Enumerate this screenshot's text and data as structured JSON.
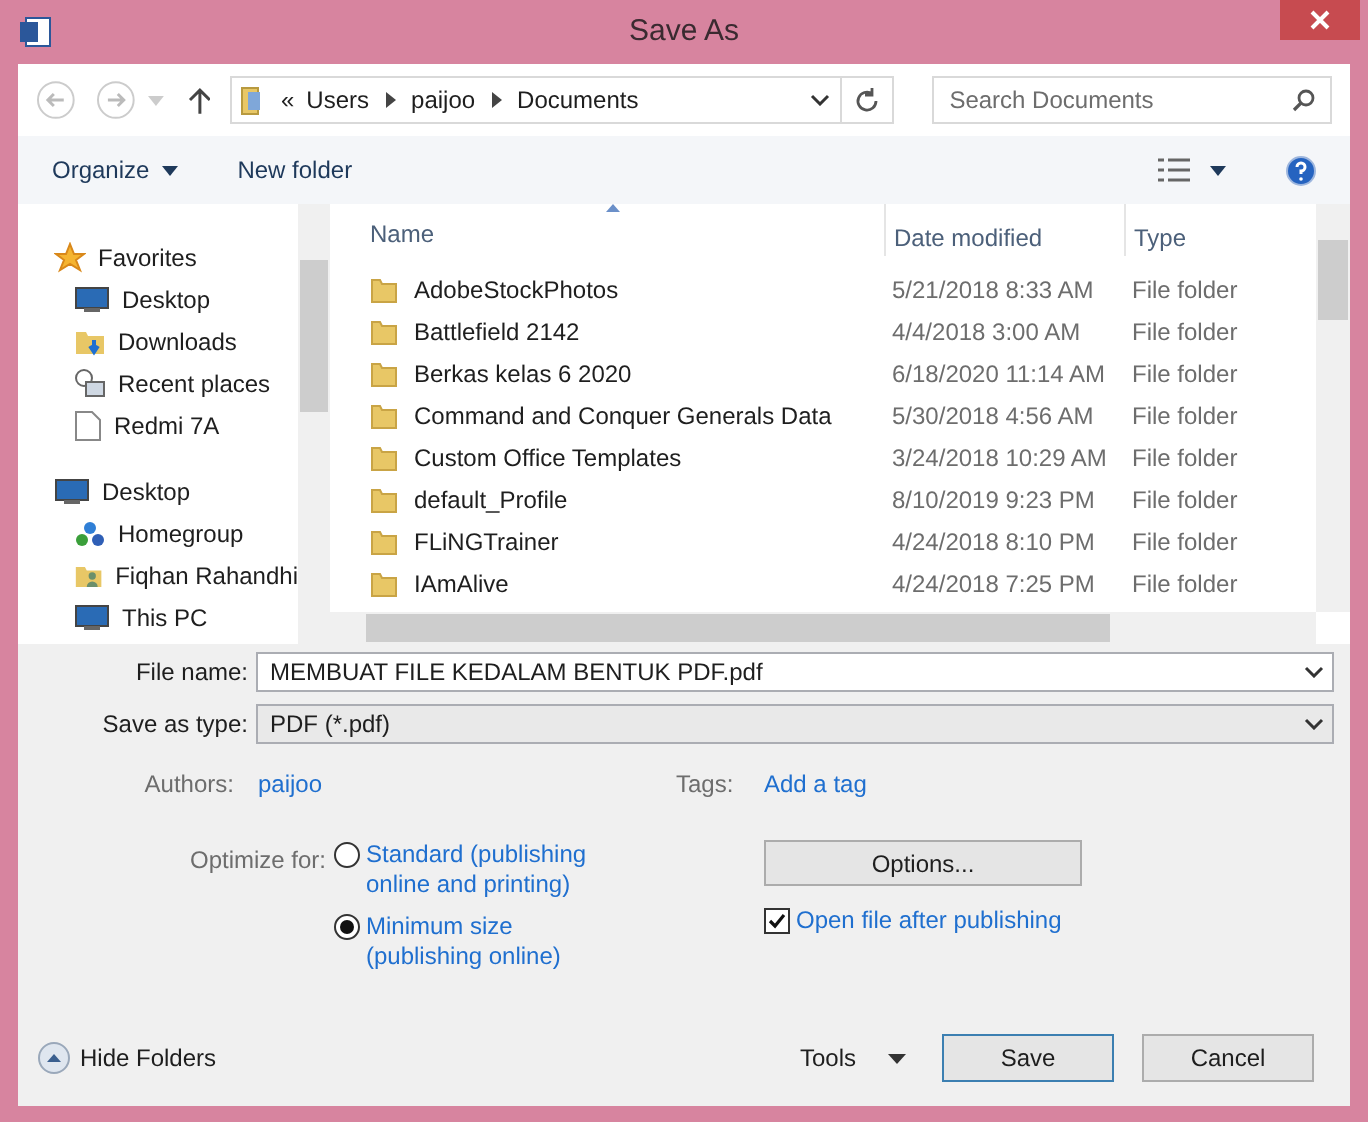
{
  "window": {
    "title": "Save As"
  },
  "address_bar": {
    "overflow": "«",
    "path": [
      "Users",
      "paijoo",
      "Documents"
    ]
  },
  "search": {
    "placeholder": "Search Documents"
  },
  "toolbar": {
    "organize": "Organize",
    "new_folder": "New folder"
  },
  "sidebar": {
    "groups": [
      {
        "label": "Favorites",
        "items": [
          {
            "label": "Desktop"
          },
          {
            "label": "Downloads"
          },
          {
            "label": "Recent places"
          },
          {
            "label": "Redmi 7A"
          }
        ]
      },
      {
        "label": "Desktop",
        "items": [
          {
            "label": "Homegroup"
          },
          {
            "label": "Fiqhan Rahandhi"
          },
          {
            "label": "This PC"
          }
        ]
      }
    ]
  },
  "file_list": {
    "columns": [
      "Name",
      "Date modified",
      "Type"
    ],
    "rows": [
      {
        "name": "AdobeStockPhotos",
        "date": "5/21/2018 8:33 AM",
        "type": "File folder"
      },
      {
        "name": "Battlefield 2142",
        "date": "4/4/2018 3:00 AM",
        "type": "File folder"
      },
      {
        "name": "Berkas kelas 6 2020",
        "date": "6/18/2020 11:14 AM",
        "type": "File folder"
      },
      {
        "name": "Command and Conquer Generals Data",
        "date": "5/30/2018 4:56 AM",
        "type": "File folder"
      },
      {
        "name": "Custom Office Templates",
        "date": "3/24/2018 10:29 AM",
        "type": "File folder"
      },
      {
        "name": "default_Profile",
        "date": "8/10/2019 9:23 PM",
        "type": "File folder"
      },
      {
        "name": "FLiNGTrainer",
        "date": "4/24/2018 8:10 PM",
        "type": "File folder"
      },
      {
        "name": "IAmAlive",
        "date": "4/24/2018 7:25 PM",
        "type": "File folder"
      }
    ]
  },
  "file_name": {
    "label": "File name:",
    "value": "MEMBUAT FILE KEDALAM BENTUK PDF.pdf"
  },
  "save_as_type": {
    "label": "Save as type:",
    "value": "PDF (*.pdf)"
  },
  "authors": {
    "label": "Authors:",
    "value": "paijoo"
  },
  "tags": {
    "label": "Tags:",
    "value": "Add a tag"
  },
  "optimize": {
    "label": "Optimize for:",
    "options": [
      {
        "label": "Standard (publishing online and printing)",
        "selected": false
      },
      {
        "label": "Minimum size (publishing online)",
        "selected": true
      }
    ]
  },
  "options_button": "Options...",
  "open_after": {
    "label": "Open file after publishing",
    "checked": true
  },
  "hide_folders": "Hide Folders",
  "tools": "Tools",
  "buttons": [
    "Save",
    "Cancel"
  ]
}
